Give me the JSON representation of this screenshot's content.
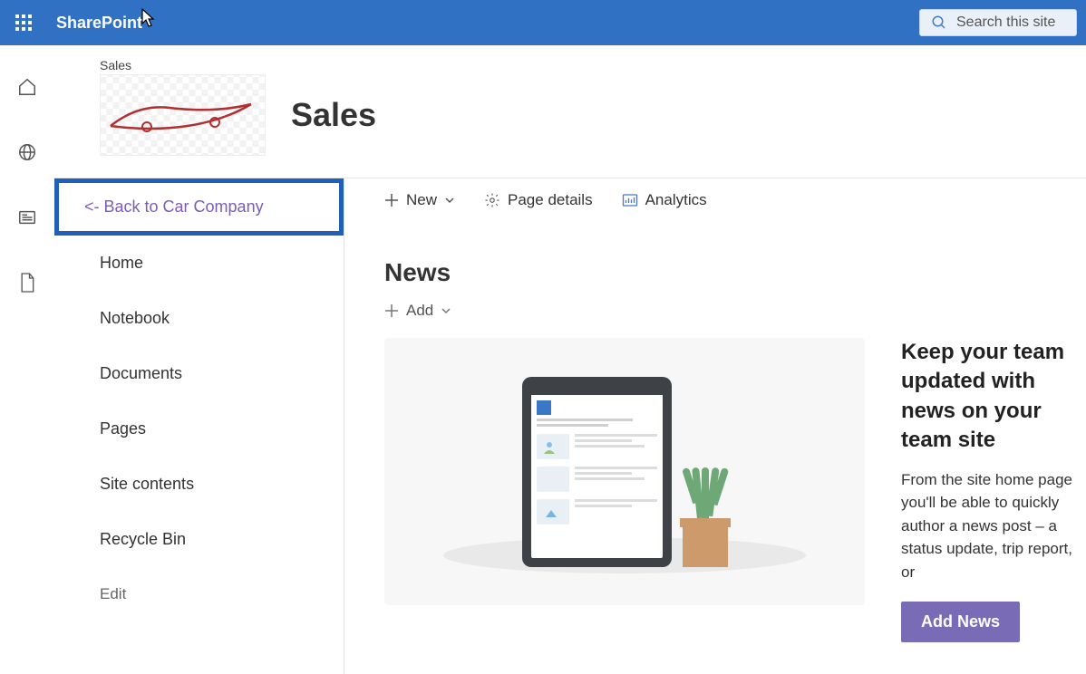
{
  "suite": {
    "appName": "SharePoint",
    "searchPlaceholder": "Search this site"
  },
  "site": {
    "breadcrumb": "Sales",
    "title": "Sales"
  },
  "leftnav": {
    "backLabel": "<- Back to Car Company",
    "items": [
      {
        "label": "Home"
      },
      {
        "label": "Notebook"
      },
      {
        "label": "Documents"
      },
      {
        "label": "Pages"
      },
      {
        "label": "Site contents"
      },
      {
        "label": "Recycle Bin"
      }
    ],
    "editLabel": "Edit"
  },
  "commandbar": {
    "newLabel": "New",
    "pageDetailsLabel": "Page details",
    "analyticsLabel": "Analytics"
  },
  "news": {
    "heading": "News",
    "addLabel": "Add",
    "cardTitle": "Keep your team updated with news on your team site",
    "cardDesc": "From the site home page you'll be able to quickly author a news post – a status update, trip report, or",
    "addNewsBtn": "Add News"
  }
}
